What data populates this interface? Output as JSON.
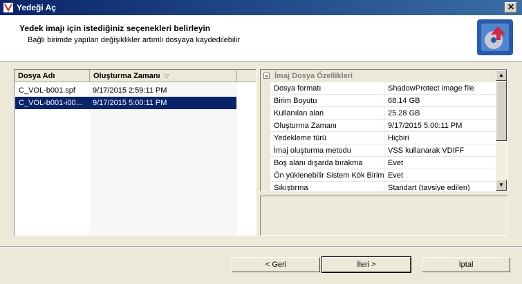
{
  "window": {
    "title": "Yedeği Aç",
    "close_glyph": "✕"
  },
  "header": {
    "title": "Yedek imajı için istediğiniz seçenekleri belirleyin",
    "subtitle": "Bağlı birimde yapılan değişiklikler artımlı dosyaya kaydedilebilir"
  },
  "file_list": {
    "columns": [
      "Dosya Adı",
      "Oluşturma Zamanı"
    ],
    "sort_glyph": "▽",
    "rows": [
      {
        "name": "C_VOL-b001.spf",
        "created": "9/17/2015 2:59:11 PM",
        "selected": false
      },
      {
        "name": "C_VOL-b001-i00...",
        "created": "9/17/2015 5:00:11 PM",
        "selected": true
      }
    ]
  },
  "properties": {
    "category": "İmaj Dosya Özellikleri",
    "collapse_glyph": "−",
    "rows": [
      {
        "name": "Dosya formatı",
        "value": "ShadowProtect image file"
      },
      {
        "name": "Birim Boyutu",
        "value": "68.14 GB"
      },
      {
        "name": "Kullanılan alan",
        "value": "25.28 GB"
      },
      {
        "name": "Oluşturma Zamanı",
        "value": "9/17/2015 5:00:11 PM"
      },
      {
        "name": "Yedekleme türü",
        "value": "Hiçbiri"
      },
      {
        "name": "İmaj oluşturma metodu",
        "value": "VSS kullanarak VDIFF"
      },
      {
        "name": "Boş alanı dışarda bırakma",
        "value": "Evet"
      },
      {
        "name": "Ön yüklenebilir Sistem Kök Birim",
        "value": "Evet"
      },
      {
        "name": "Sıkıştırma",
        "value": "Standart (tavsiye edilen)"
      }
    ],
    "scroll_up_glyph": "▲",
    "scroll_down_glyph": "▼"
  },
  "buttons": {
    "back": "< Geri",
    "next": "İleri >",
    "cancel": "İptal"
  },
  "colors": {
    "titlebar": "#0a246a",
    "selection": "#0a246a",
    "face": "#ece9d8"
  },
  "icons": {
    "title": "app-icon",
    "header": "disk-restore-icon"
  }
}
